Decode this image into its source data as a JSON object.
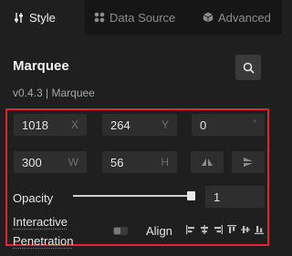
{
  "tabs": [
    {
      "label": "Style",
      "icon": "style-icon",
      "active": true
    },
    {
      "label": "Data Source",
      "icon": "data-source-icon",
      "active": false
    },
    {
      "label": "Advanced",
      "icon": "advanced-icon",
      "active": false
    }
  ],
  "component": {
    "name": "Marquee",
    "version_line": "v0.4.3 | Marquee"
  },
  "position": {
    "x": {
      "value": "1018",
      "suffix": "X"
    },
    "y": {
      "value": "264",
      "suffix": "Y"
    },
    "rotation": {
      "value": "0",
      "suffix": "°"
    },
    "width": {
      "value": "300",
      "suffix": "W"
    },
    "height": {
      "value": "56",
      "suffix": "H"
    }
  },
  "opacity": {
    "label": "Opacity",
    "value": "1",
    "level": 1.0
  },
  "interactive": {
    "label_line1": "Interactive",
    "label_line2": "Penetration",
    "enabled": false
  },
  "align": {
    "label": "Align",
    "icons": [
      "align-left-icon",
      "align-center-horizontal-icon",
      "align-right-icon",
      "align-top-icon",
      "align-middle-vertical-icon",
      "align-bottom-icon"
    ]
  },
  "colors": {
    "highlight_border": "#e0262e",
    "field_bg": "#2e2e2e",
    "panel_bg": "#1f1f1f"
  }
}
